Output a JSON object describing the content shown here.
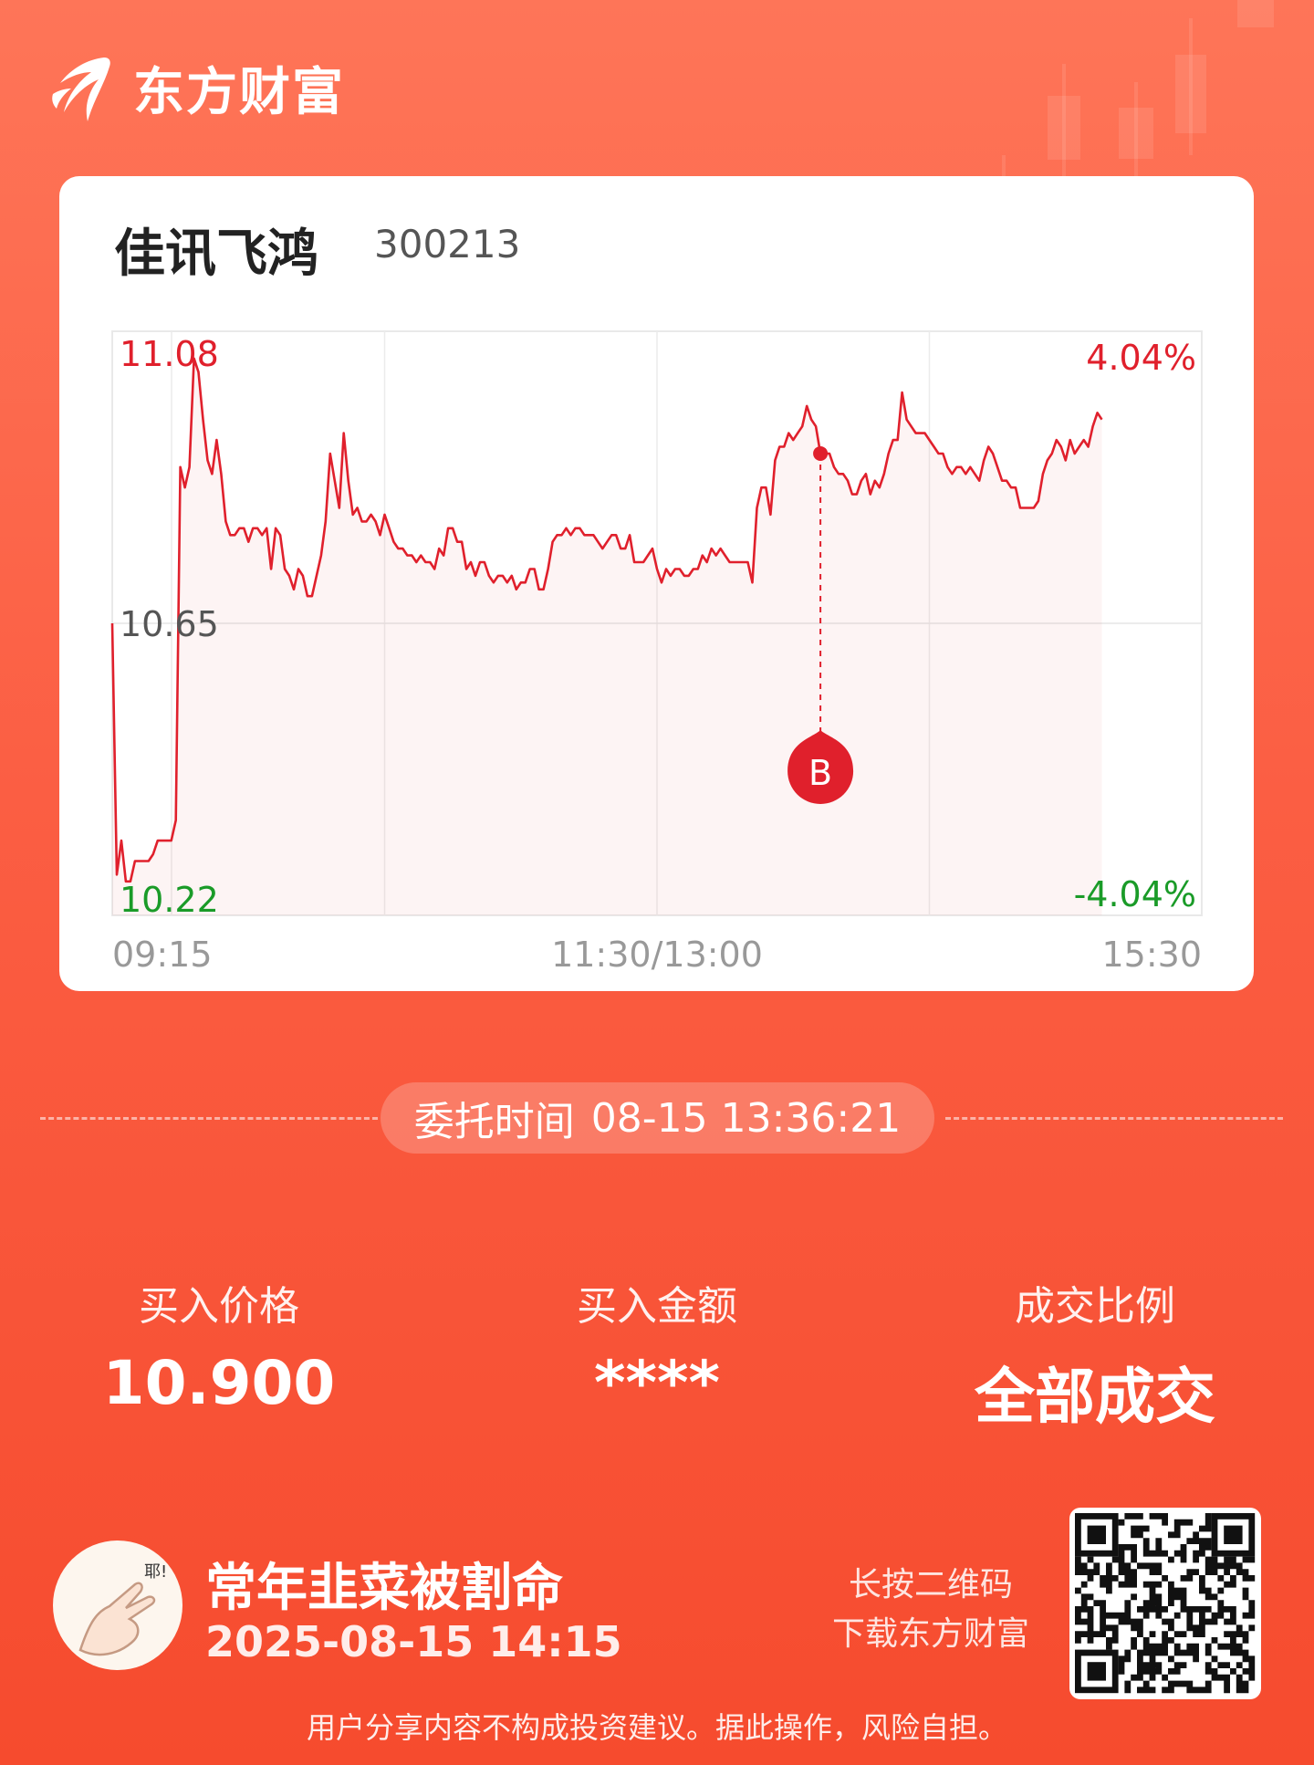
{
  "brand": {
    "name": "东方财富",
    "logo_icon": "eastmoney-leaf-icon"
  },
  "stock": {
    "name": "佳讯飞鸿",
    "code": "300213"
  },
  "chart_data": {
    "type": "line",
    "title": "",
    "prev_close": 10.65,
    "ylim": [
      10.22,
      11.08
    ],
    "y_tick_labels_left": [
      "11.08",
      "10.65",
      "10.22"
    ],
    "y_tick_labels_right": [
      "4.04%",
      "-4.04%"
    ],
    "x_tick_labels": [
      "09:15",
      "11:30/13:00",
      "15:30"
    ],
    "grid": true,
    "colors": {
      "up": "#e0202c",
      "down": "#1a9b28",
      "neutral": "#555555",
      "line": "#e0202c"
    },
    "series": [
      {
        "values": [
          10.65,
          10.28,
          10.33,
          10.27,
          10.27,
          10.3,
          10.3,
          10.3,
          10.3,
          10.31,
          10.33,
          10.33,
          10.33,
          10.33,
          10.36,
          10.88,
          10.85,
          10.88,
          11.04,
          11.02,
          10.95,
          10.89,
          10.87,
          10.92,
          10.87,
          10.8,
          10.78,
          10.78,
          10.79,
          10.79,
          10.77,
          10.79,
          10.79,
          10.78,
          10.79,
          10.73,
          10.79,
          10.78,
          10.73,
          10.72,
          10.7,
          10.73,
          10.72,
          10.69,
          10.69,
          10.72,
          10.75,
          10.8,
          10.9,
          10.86,
          10.82,
          10.93,
          10.86,
          10.81,
          10.82,
          10.8,
          10.8,
          10.81,
          10.8,
          10.78,
          10.81,
          10.79,
          10.77,
          10.76,
          10.76,
          10.75,
          10.75,
          10.74,
          10.75,
          10.74,
          10.74,
          10.73,
          10.76,
          10.75,
          10.79,
          10.79,
          10.77,
          10.77,
          10.73,
          10.74,
          10.72,
          10.74,
          10.74,
          10.72,
          10.71,
          10.72,
          10.72,
          10.71,
          10.72,
          10.7,
          10.71,
          10.71,
          10.73,
          10.73,
          10.7,
          10.7,
          10.73,
          10.77,
          10.78,
          10.78,
          10.79,
          10.78,
          10.79,
          10.79,
          10.78,
          10.78,
          10.78,
          10.77,
          10.76,
          10.77,
          10.78,
          10.78,
          10.76,
          10.76,
          10.78,
          10.74,
          10.74,
          10.74,
          10.75,
          10.76,
          10.73,
          10.71,
          10.73,
          10.72,
          10.73,
          10.73,
          10.72,
          10.72,
          10.73,
          10.73,
          10.75,
          10.74,
          10.76,
          10.75,
          10.76,
          10.75,
          10.74,
          10.74,
          10.74,
          10.74,
          10.74,
          10.71,
          10.82,
          10.85,
          10.85,
          10.81,
          10.89,
          10.91,
          10.91,
          10.93,
          10.92,
          10.93,
          10.94,
          10.97,
          10.95,
          10.94,
          10.9,
          10.9,
          10.9,
          10.88,
          10.87,
          10.87,
          10.86,
          10.84,
          10.84,
          10.86,
          10.87,
          10.84,
          10.86,
          10.85,
          10.87,
          10.9,
          10.92,
          10.92,
          10.99,
          10.95,
          10.94,
          10.93,
          10.93,
          10.93,
          10.92,
          10.91,
          10.9,
          10.9,
          10.88,
          10.87,
          10.88,
          10.88,
          10.87,
          10.88,
          10.87,
          10.86,
          10.89,
          10.91,
          10.9,
          10.88,
          10.86,
          10.86,
          10.85,
          10.85,
          10.82,
          10.82,
          10.82,
          10.82,
          10.83,
          10.87,
          10.89,
          10.9,
          10.92,
          10.91,
          10.89,
          10.92,
          10.9,
          10.91,
          10.92,
          10.91,
          10.94,
          10.96,
          10.95
        ]
      }
    ],
    "marker": {
      "label": "B",
      "price": 10.9,
      "time": "13:36"
    }
  },
  "order_time": {
    "label": "委托时间",
    "value": "08-15 13:36:21"
  },
  "stats": [
    {
      "label": "买入价格",
      "value": "10.900"
    },
    {
      "label": "买入金额",
      "value": "****"
    },
    {
      "label": "成交比例",
      "value": "全部成交"
    }
  ],
  "user": {
    "name": "常年韭菜被割命",
    "time": "2025-08-15 14:15",
    "avatar_icon": "hand-gesture-avatar-icon",
    "avatar_text": "耶!"
  },
  "qr": {
    "line1": "长按二维码",
    "line2": "下载东方财富",
    "icon": "qr-code-icon"
  },
  "disclaimer": "用户分享内容不构成投资建议。据此操作，风险自担。"
}
